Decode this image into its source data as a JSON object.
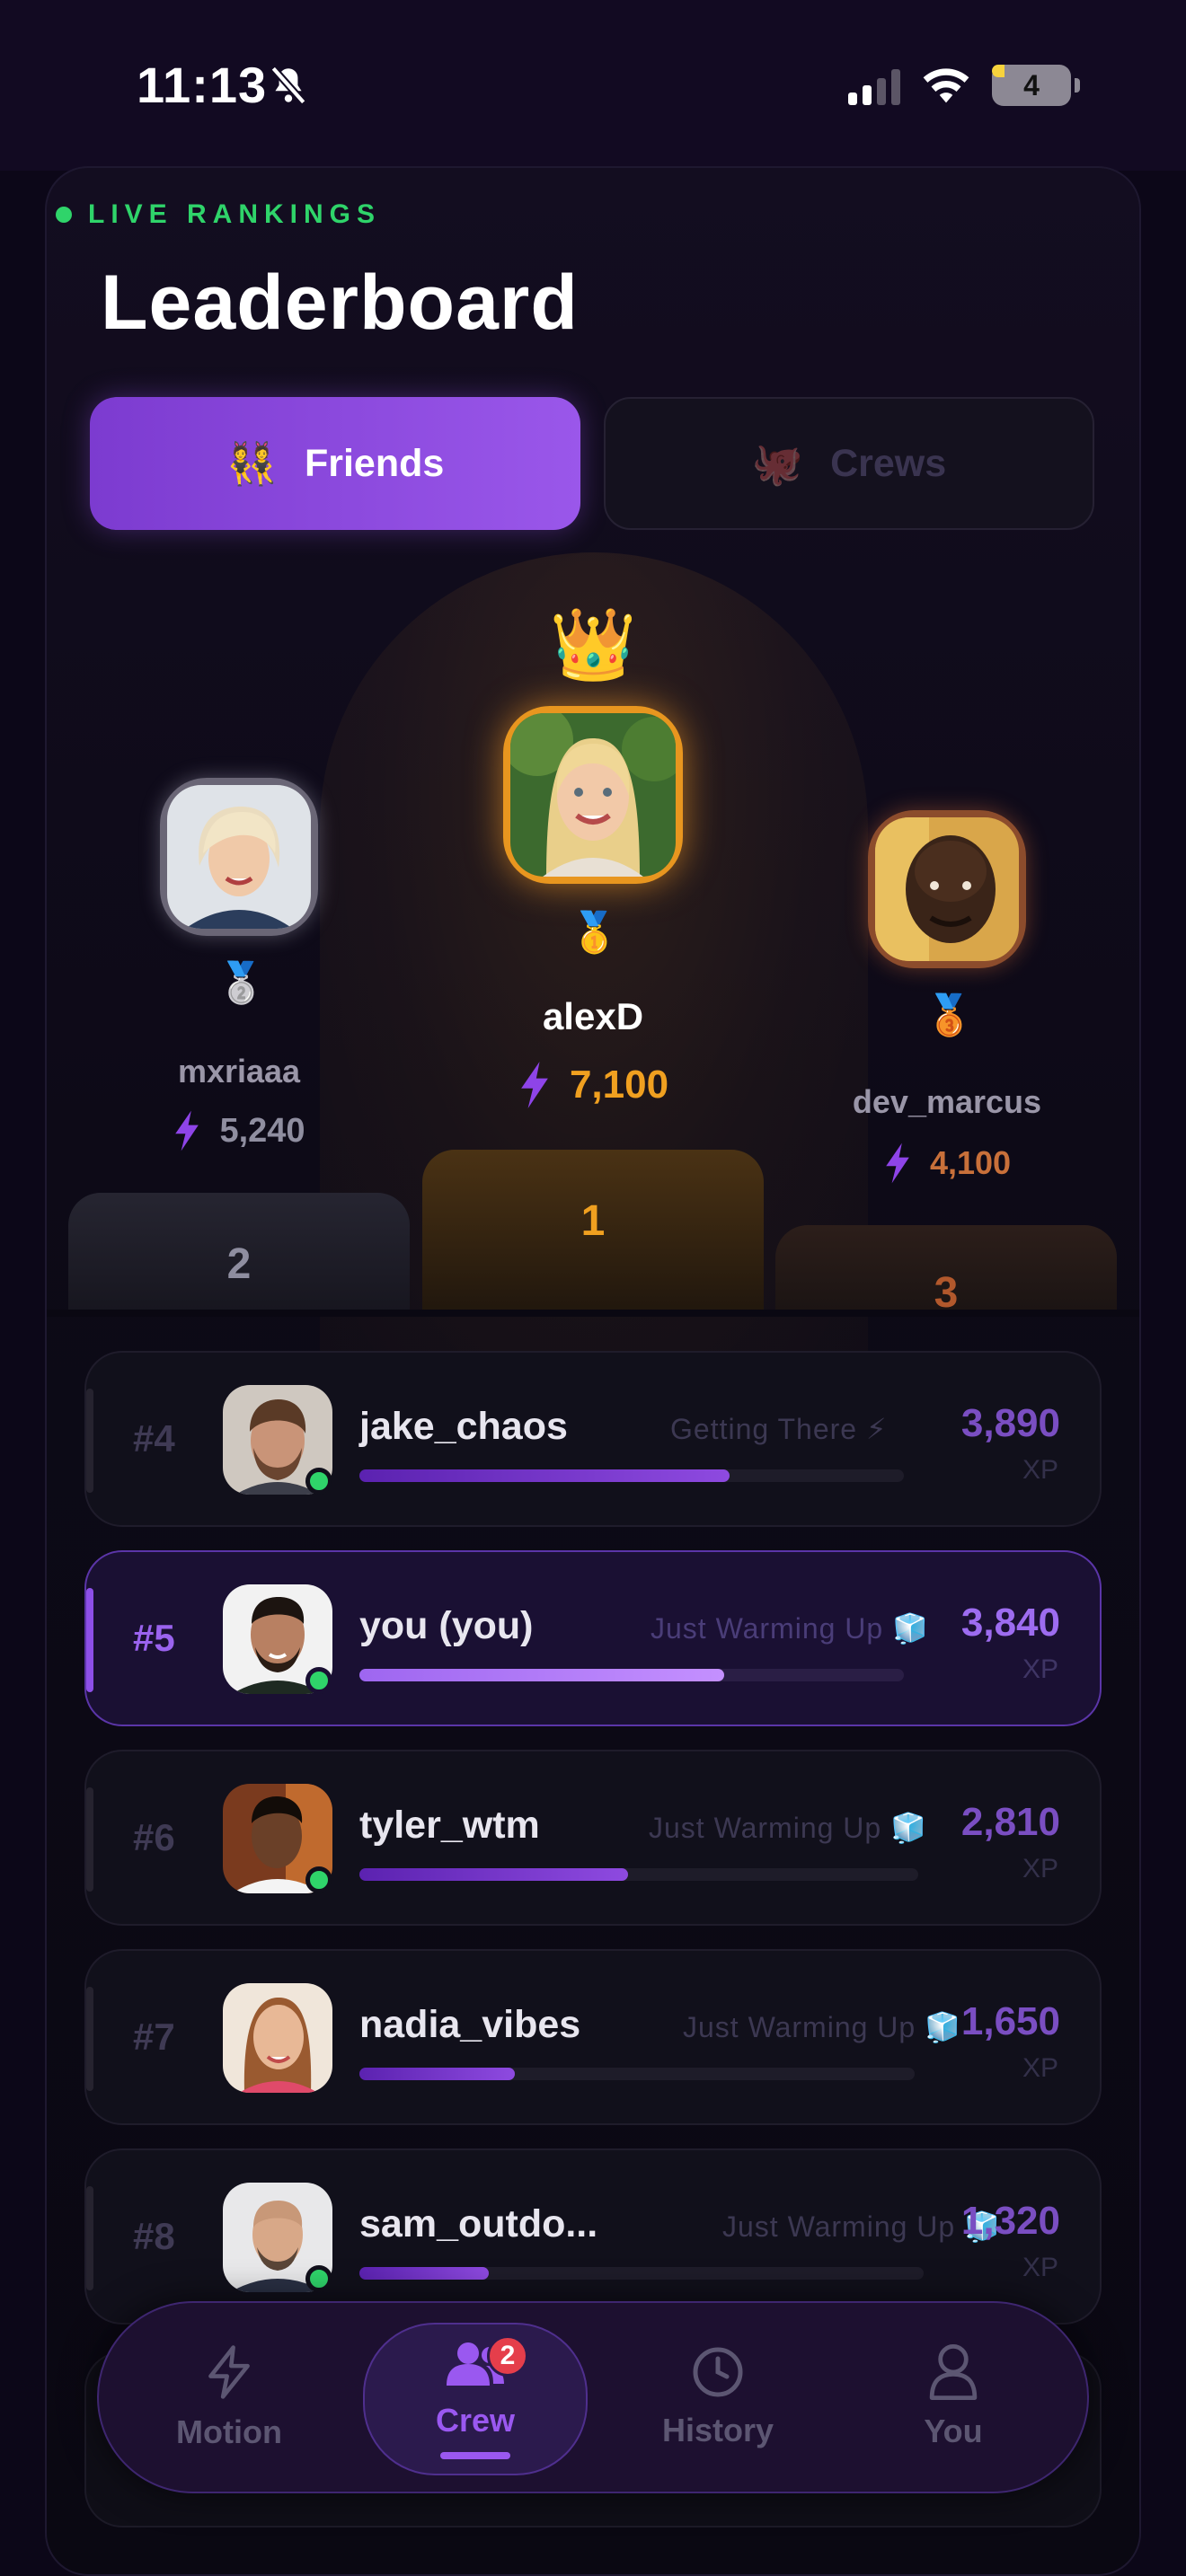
{
  "status_bar": {
    "time": "11:13",
    "battery": "4"
  },
  "header": {
    "live_label": "LIVE RANKINGS",
    "title": "Leaderboard"
  },
  "tabs": [
    {
      "label": "Friends",
      "icon": "👯",
      "active": true
    },
    {
      "label": "Crews",
      "icon": "🐙",
      "active": false
    }
  ],
  "podium": {
    "first": {
      "name": "alexD",
      "xp": "7,100",
      "rank": "1",
      "medal": "🥇",
      "crown": "👑"
    },
    "second": {
      "name": "mxriaaa",
      "xp": "5,240",
      "rank": "2",
      "medal": "🥈"
    },
    "third": {
      "name": "dev_marcus",
      "xp": "4,100",
      "rank": "3",
      "medal": "🥉"
    }
  },
  "rows": [
    {
      "rank": "#4",
      "name": "jake_chaos",
      "tier": "Getting There ⚡",
      "xp": "3,890",
      "unit": "XP",
      "progress": 0.68,
      "online": true,
      "me": false
    },
    {
      "rank": "#5",
      "name": "you  (you)",
      "tier": "Just Warming Up 🧊",
      "xp": "3,840",
      "unit": "XP",
      "progress": 0.67,
      "online": true,
      "me": true
    },
    {
      "rank": "#6",
      "name": "tyler_wtm",
      "tier": "Just Warming Up 🧊",
      "xp": "2,810",
      "unit": "XP",
      "progress": 0.48,
      "online": true,
      "me": false
    },
    {
      "rank": "#7",
      "name": "nadia_vibes",
      "tier": "Just Warming Up 🧊",
      "xp": "1,650",
      "unit": "XP",
      "progress": 0.28,
      "online": false,
      "me": false
    },
    {
      "rank": "#8",
      "name": "sam_outdo...",
      "tier": "Just Warming Up 🧊",
      "xp": "1,320",
      "unit": "XP",
      "progress": 0.23,
      "online": true,
      "me": false
    }
  ],
  "nav": [
    {
      "label": "Motion",
      "icon": "bolt-icon"
    },
    {
      "label": "Crew",
      "icon": "people-icon",
      "badge": "2",
      "active": true
    },
    {
      "label": "History",
      "icon": "clock-icon"
    },
    {
      "label": "You",
      "icon": "person-icon"
    }
  ],
  "colors": {
    "accent": "#9a58f0",
    "gold": "#f0a020",
    "live": "#2fd46a",
    "bronze": "#c8703a"
  }
}
